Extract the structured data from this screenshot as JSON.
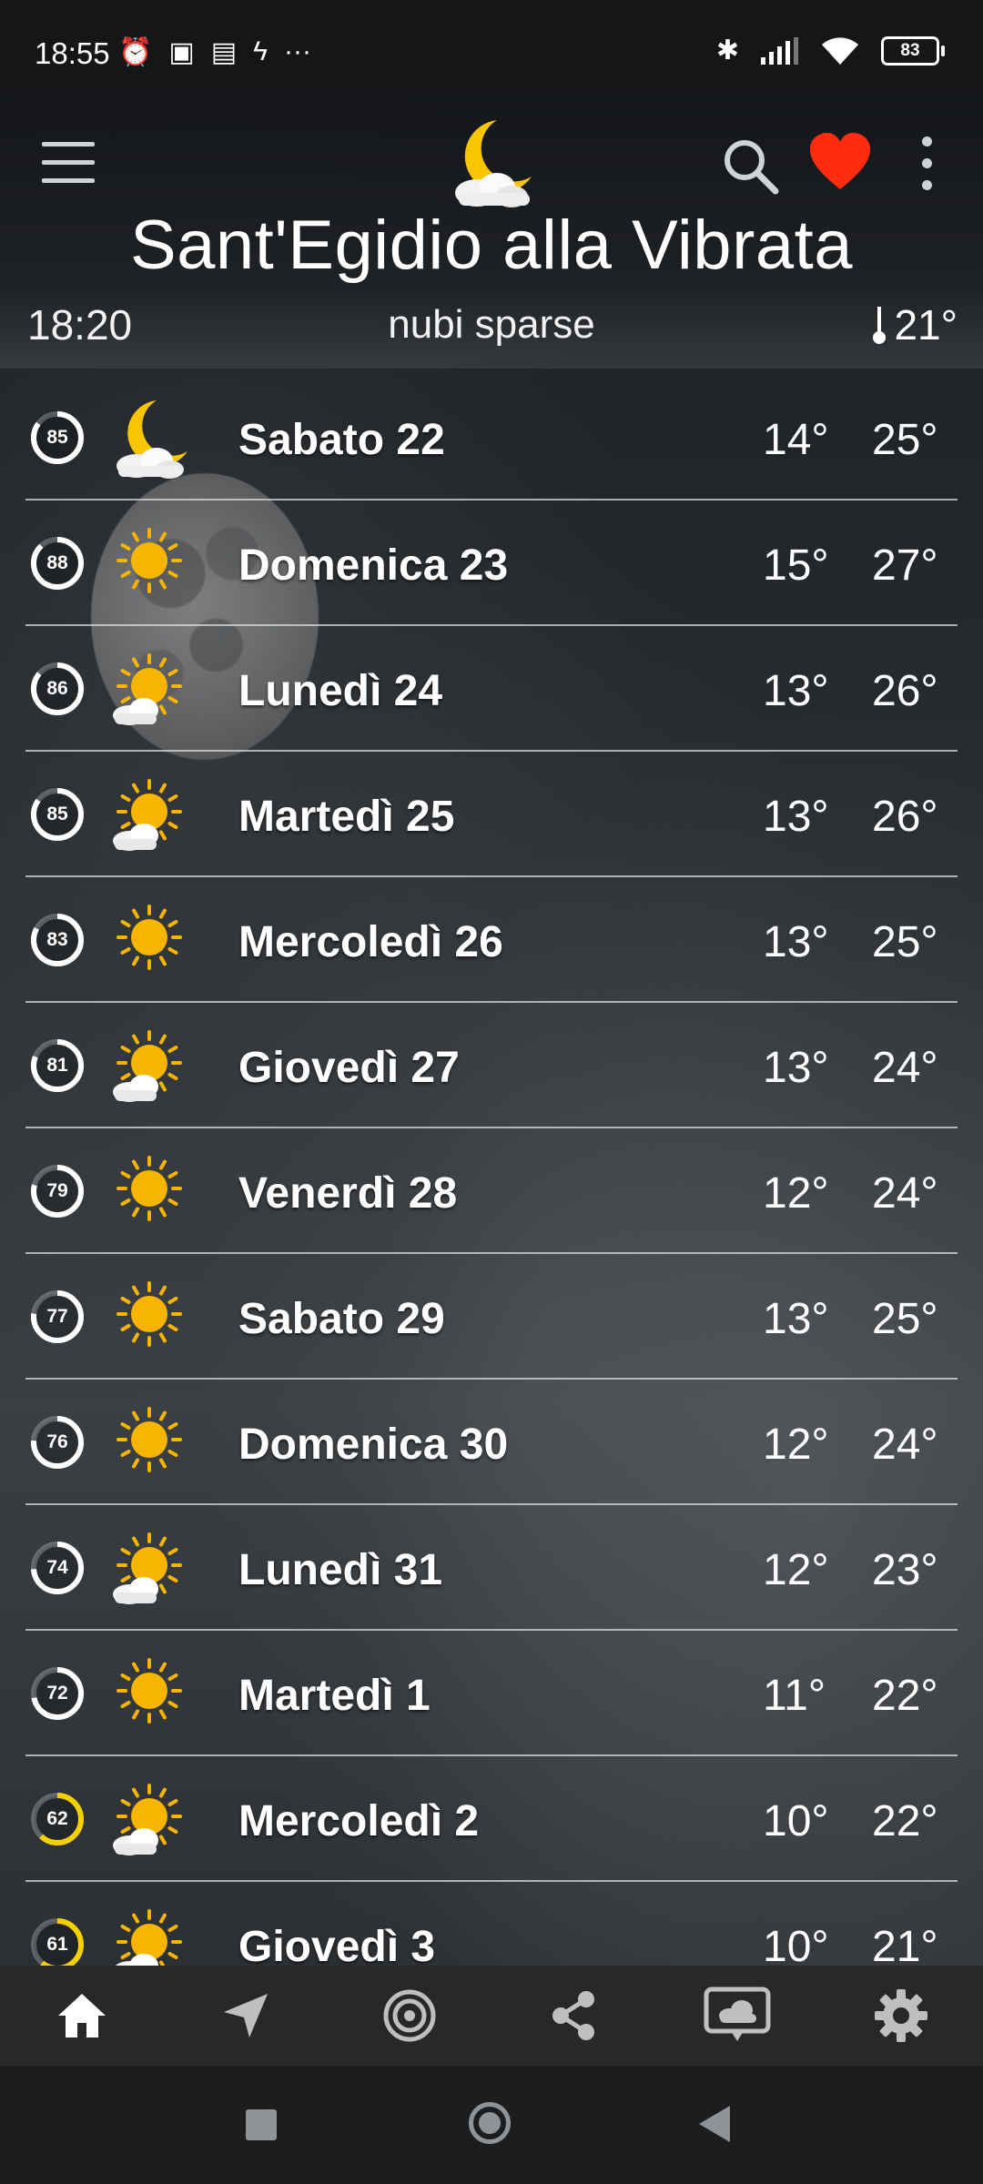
{
  "status_bar": {
    "time": "18:55",
    "battery": "83"
  },
  "header": {
    "city": "Sant'Egidio alla Vibrata",
    "time": "18:20",
    "condition": "nubi sparse",
    "temperature": "21°"
  },
  "forecast": [
    {
      "score": "85",
      "score_fraction": 0.85,
      "icon": "moon-cloud-icon",
      "day": "Sabato 22",
      "min": "14°",
      "max": "25°"
    },
    {
      "score": "88",
      "score_fraction": 0.88,
      "icon": "sun-icon",
      "day": "Domenica 23",
      "min": "15°",
      "max": "27°"
    },
    {
      "score": "86",
      "score_fraction": 0.86,
      "icon": "sun-cloud-icon",
      "day": "Lunedì 24",
      "min": "13°",
      "max": "26°"
    },
    {
      "score": "85",
      "score_fraction": 0.85,
      "icon": "sun-cloud-icon",
      "day": "Martedì 25",
      "min": "13°",
      "max": "26°"
    },
    {
      "score": "83",
      "score_fraction": 0.83,
      "icon": "sun-icon",
      "day": "Mercoledì 26",
      "min": "13°",
      "max": "25°"
    },
    {
      "score": "81",
      "score_fraction": 0.81,
      "icon": "sun-cloud-icon",
      "day": "Giovedì 27",
      "min": "13°",
      "max": "24°"
    },
    {
      "score": "79",
      "score_fraction": 0.79,
      "icon": "sun-icon",
      "day": "Venerdì 28",
      "min": "12°",
      "max": "24°"
    },
    {
      "score": "77",
      "score_fraction": 0.77,
      "icon": "sun-icon",
      "day": "Sabato 29",
      "min": "13°",
      "max": "25°"
    },
    {
      "score": "76",
      "score_fraction": 0.76,
      "icon": "sun-icon",
      "day": "Domenica 30",
      "min": "12°",
      "max": "24°"
    },
    {
      "score": "74",
      "score_fraction": 0.74,
      "icon": "sun-cloud-icon",
      "day": "Lunedì 31",
      "min": "12°",
      "max": "23°"
    },
    {
      "score": "72",
      "score_fraction": 0.72,
      "icon": "sun-icon",
      "day": "Martedì 1",
      "min": "11°",
      "max": "22°"
    },
    {
      "score": "62",
      "score_fraction": 0.62,
      "icon": "sun-cloud-icon",
      "day": "Mercoledì 2",
      "min": "10°",
      "max": "22°"
    },
    {
      "score": "61",
      "score_fraction": 0.61,
      "icon": "sun-cloud-icon",
      "day": "Giovedì 3",
      "min": "10°",
      "max": "21°"
    }
  ],
  "colors": {
    "score_ring_high": "#ffffff",
    "score_ring_low": "#f5d000",
    "favorite": "#ff2d0f",
    "sun": "#f7b500"
  },
  "bottom_nav": [
    "home-icon",
    "location-arrow-icon",
    "radar-icon",
    "share-icon",
    "weather-chat-icon",
    "settings-icon"
  ]
}
